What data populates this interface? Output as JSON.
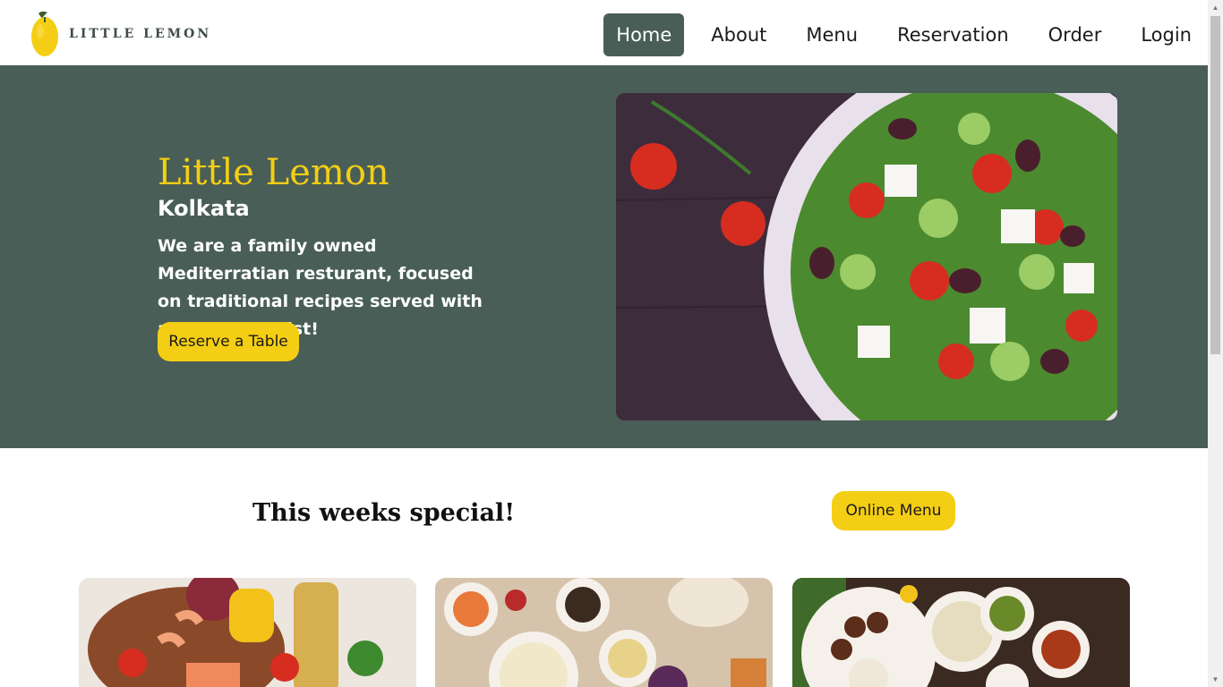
{
  "brand": {
    "logo_text": "LITTLE LEMON"
  },
  "nav": {
    "items": [
      {
        "label": "Home",
        "active": true
      },
      {
        "label": "About"
      },
      {
        "label": "Menu"
      },
      {
        "label": "Reservation"
      },
      {
        "label": "Order"
      },
      {
        "label": "Login"
      }
    ]
  },
  "hero": {
    "title": "Little Lemon",
    "subtitle": "Kolkata",
    "description": "We are a family owned Mediterratian resturant, focused on traditional recipes served with a mordern twist!",
    "cta_label": "Reserve a Table"
  },
  "specials": {
    "title": "This weeks special!",
    "cta_label": "Online Menu"
  },
  "colors": {
    "primary_green": "#495e57",
    "primary_yellow": "#f4ce14"
  }
}
